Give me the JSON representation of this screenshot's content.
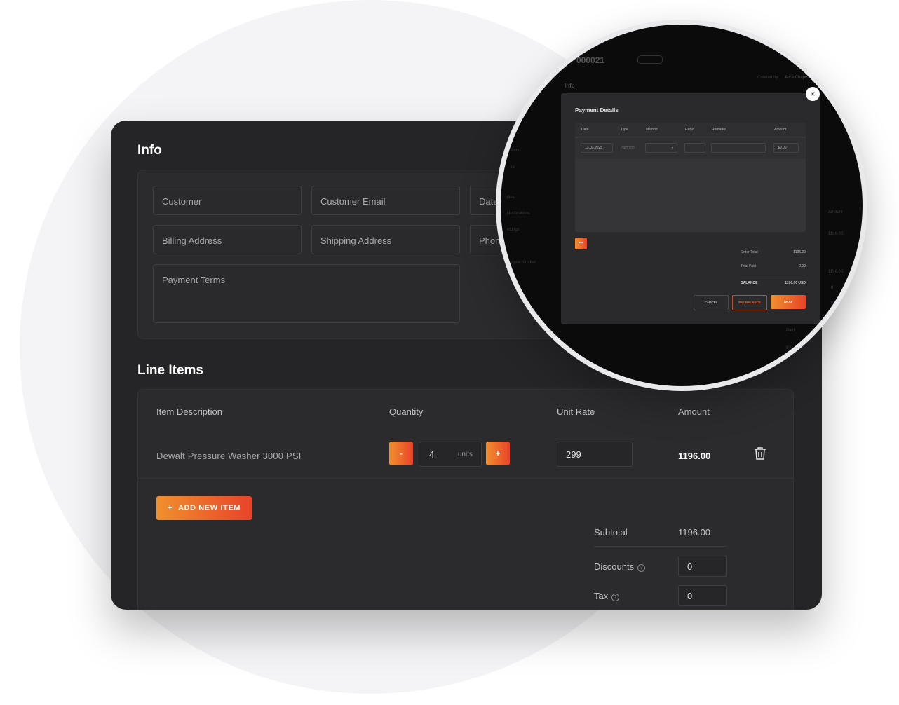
{
  "info": {
    "title": "Info",
    "fields": {
      "customer": "Customer",
      "customer_email": "Customer Email",
      "date": "Date",
      "billing_address": "Billing Address",
      "shipping_address": "Shipping Address",
      "phone": "Phone",
      "payment_terms": "Payment Terms"
    }
  },
  "line_items": {
    "title": "Line Items",
    "columns": [
      "Item Description",
      "Quantity",
      "Unit Rate",
      "Amount"
    ],
    "rows": [
      {
        "description": "Dewalt Pressure Washer 3000 PSI",
        "quantity": "4",
        "unit": "units",
        "unit_rate": "299",
        "amount": "1196.00"
      }
    ],
    "decrement_label": "-",
    "increment_label": "+",
    "add_button": "ADD NEW ITEM",
    "add_icon": "+"
  },
  "summary": {
    "subtotal_label": "Subtotal",
    "subtotal_value": "1196.00",
    "discounts_label": "Discounts",
    "discounts_value": "0",
    "tax_label": "Tax",
    "tax_value": "0",
    "help_glyph": "?"
  },
  "background_page": {
    "order_id": "000021",
    "created_by_label": "Created by",
    "created_by": "Alice Chapman",
    "info": "Info",
    "sidebar_fragments": [
      "ents",
      "ial",
      "ities",
      "Notifications",
      "ettings",
      "apse Sidebar"
    ],
    "amount_header": "Amount",
    "amount_value": "1196.00",
    "amount_value_2": "1196.00",
    "zero_1": "0",
    "zero_2": "0",
    "paid": "Paid",
    "balance": "BALANCE"
  },
  "modal": {
    "title": "Payment Details",
    "columns": [
      "Date",
      "Type",
      "Method",
      "Ref #",
      "Remarks",
      "Amount"
    ],
    "row": {
      "date": "13.03.2025",
      "type": "Payment",
      "amount": "$0.00"
    },
    "add_glyph": "•••",
    "order_total_label": "Order Total",
    "order_total_value": "1196.00",
    "total_paid_label": "Total Paid",
    "total_paid_value": "0.00",
    "balance_label": "BALANCE",
    "balance_value": "1196.00 USD",
    "cancel": "CANCEL",
    "pay_balance": "PAY BALANCE",
    "okay": "OKAY",
    "close_glyph": "×"
  },
  "colors": {
    "accent_start": "#f0902c",
    "accent_end": "#e8432a",
    "card_bg": "#252527"
  }
}
